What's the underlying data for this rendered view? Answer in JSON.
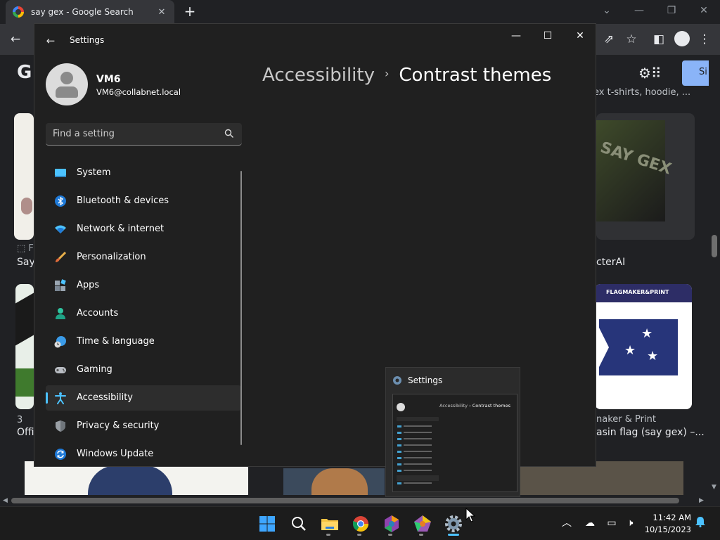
{
  "browser": {
    "tab_title": "say gex - Google Search",
    "tab_close_glyph": "✕",
    "new_tab_glyph": "+",
    "page": {
      "logo_letter": "G",
      "sign_in_label": "Si",
      "captions": {
        "top_right": "ex t-shirts, hoodie, ...",
        "left_a": "Say",
        "left_b": "Offi",
        "left_c": "3",
        "mid_right": "cterAI",
        "flag_brand": "FLAGMAKER&PRINT",
        "maker": "naker & Print",
        "flag_title": "asin flag (say gex) –...",
        "gex_art": "SAY GEX"
      }
    }
  },
  "settings": {
    "window_title": "Settings",
    "user": {
      "name": "VM6",
      "email": "VM6@collabnet.local"
    },
    "search": {
      "placeholder": "Find a setting"
    },
    "nav_items": [
      {
        "label": "System"
      },
      {
        "label": "Bluetooth & devices"
      },
      {
        "label": "Network & internet"
      },
      {
        "label": "Personalization"
      },
      {
        "label": "Apps"
      },
      {
        "label": "Accounts"
      },
      {
        "label": "Time & language"
      },
      {
        "label": "Gaming"
      },
      {
        "label": "Accessibility",
        "active": true
      },
      {
        "label": "Privacy & security"
      },
      {
        "label": "Windows Update"
      }
    ],
    "breadcrumb": {
      "parent": "Accessibility",
      "separator": "›",
      "current": "Contrast themes"
    }
  },
  "preview": {
    "title": "Settings",
    "thumb_breadcrumb_parent": "Accessibility",
    "thumb_breadcrumb_current": "Contrast themes"
  },
  "taskbar": {
    "apps": [
      "start-icon",
      "search-icon",
      "file-explorer-icon",
      "chrome-icon",
      "app-icon-hexagon",
      "app-icon-pentagon",
      "settings-icon"
    ],
    "clock": {
      "time": "11:42 AM",
      "date": "10/15/2023"
    }
  },
  "colors": {
    "accent": "#4cc2ff",
    "settings_bg": "#202020",
    "chrome_bg": "#202124"
  }
}
